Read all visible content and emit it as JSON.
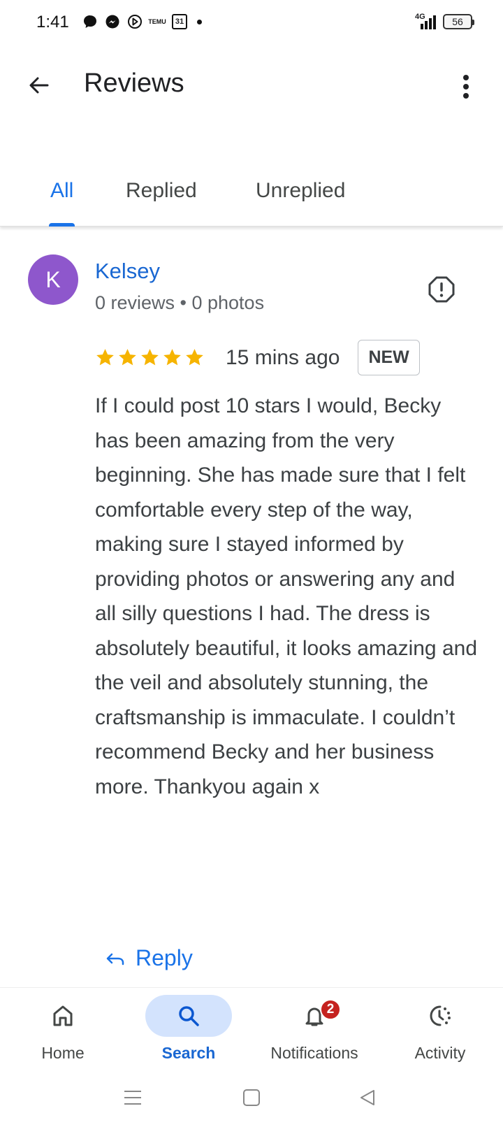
{
  "status_bar": {
    "time": "1:41",
    "temu_label": "TEMU",
    "calendar_day": "31",
    "network": "4G",
    "battery": "56"
  },
  "app_bar": {
    "title": "Reviews"
  },
  "tabs": [
    {
      "label": "All",
      "active": true
    },
    {
      "label": "Replied",
      "active": false
    },
    {
      "label": "Unreplied",
      "active": false
    }
  ],
  "review": {
    "avatar_initial": "K",
    "avatar_color": "#8e57cc",
    "reviewer_name": "Kelsey",
    "reviewer_meta": "0 reviews • 0 photos",
    "rating": 5,
    "time_ago": "15 mins ago",
    "badge": "NEW",
    "text": "If I could post 10 stars I would, Becky has been amazing from the very beginning. She has made sure that I felt comfortable every step of the way, making sure I stayed informed by providing photos or answering any and all silly questions I had. The dress is absolutely beautiful, it looks amazing and the veil and absolutely stunning, the craftsmanship is immaculate. I couldn’t recommend Becky and her business more. Thankyou again x",
    "reply_label": "Reply"
  },
  "bottom_nav": [
    {
      "label": "Home",
      "icon": "home-icon",
      "active": false
    },
    {
      "label": "Search",
      "icon": "search-icon",
      "active": true
    },
    {
      "label": "Notifications",
      "icon": "bell-icon",
      "active": false,
      "badge": "2"
    },
    {
      "label": "Activity",
      "icon": "activity-icon",
      "active": false
    }
  ],
  "colors": {
    "accent": "#1a73e8",
    "star": "#f6b400",
    "badge": "#c5221f"
  }
}
